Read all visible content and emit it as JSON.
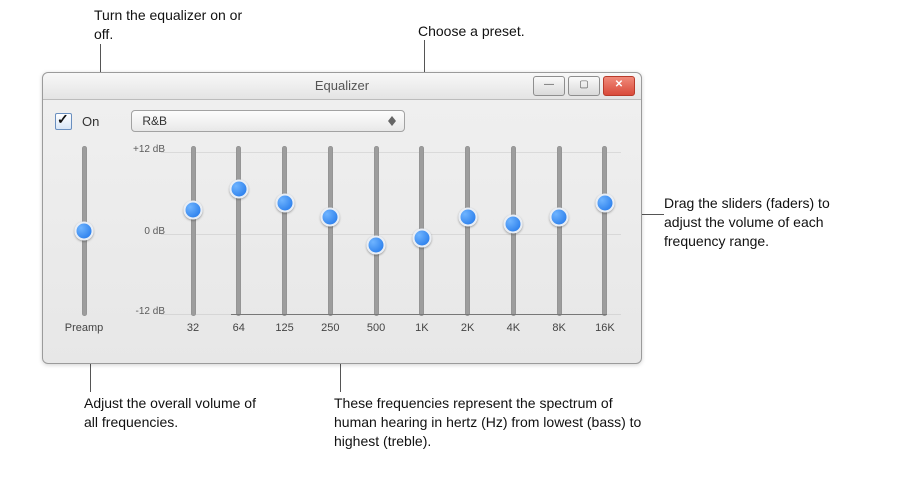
{
  "window": {
    "title": "Equalizer"
  },
  "controls": {
    "on_label": "On",
    "on_checked": true,
    "preset_selected": "R&B"
  },
  "db_labels": {
    "p12": "+12 dB",
    "zero": "0 dB",
    "m12": "-12 dB"
  },
  "preamp": {
    "label": "Preamp",
    "value_db": 0
  },
  "bands": [
    {
      "freq": "32",
      "value_db": 3
    },
    {
      "freq": "64",
      "value_db": 6
    },
    {
      "freq": "125",
      "value_db": 4
    },
    {
      "freq": "250",
      "value_db": 2
    },
    {
      "freq": "500",
      "value_db": -2
    },
    {
      "freq": "1K",
      "value_db": -1
    },
    {
      "freq": "2K",
      "value_db": 2
    },
    {
      "freq": "4K",
      "value_db": 1
    },
    {
      "freq": "8K",
      "value_db": 2
    },
    {
      "freq": "16K",
      "value_db": 4
    }
  ],
  "callouts": {
    "onoff": "Turn the equalizer on or off.",
    "preset": "Choose a preset.",
    "sliders": "Drag the sliders (faders) to adjust the volume of each frequency range.",
    "preamp": "Adjust the overall volume of all frequencies.",
    "freqs": "These frequencies represent the spectrum of human hearing in hertz (Hz) from lowest (bass) to highest (treble)."
  }
}
